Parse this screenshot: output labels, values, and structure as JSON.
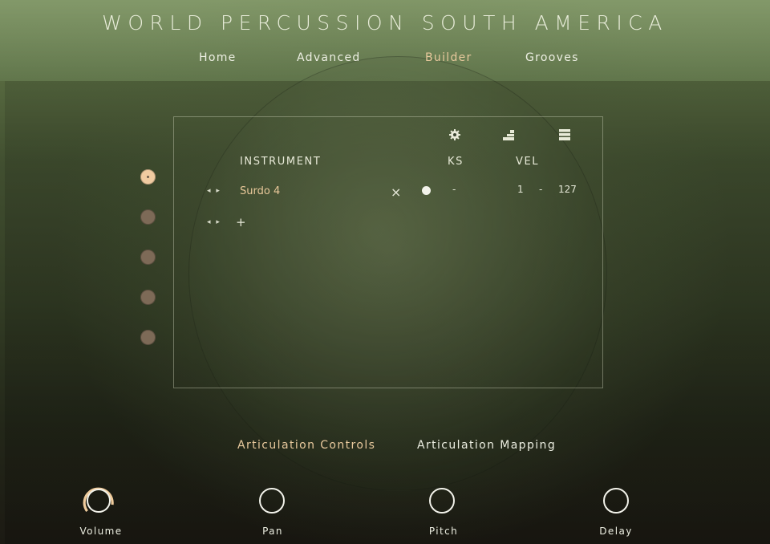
{
  "app": {
    "title": "WORLD PERCUSSION SOUTH AMERICA"
  },
  "nav": [
    {
      "label": "Home",
      "active": false
    },
    {
      "label": "Advanced",
      "active": false
    },
    {
      "label": "Builder",
      "active": true
    },
    {
      "label": "Grooves",
      "active": false
    }
  ],
  "builder": {
    "header_icons": [
      "gear-icon",
      "stairs-icon",
      "list-icon"
    ],
    "columns": {
      "instrument": "INSTRUMENT",
      "ks": "KS",
      "vel": "VEL"
    },
    "rows": [
      {
        "instrument": "Surdo 4",
        "ks_from": "-",
        "vel_low": "1",
        "vel_sep": "-",
        "vel_high": "127"
      }
    ],
    "add_label": "+",
    "remove_label": "×",
    "arrows": "◂ ▸",
    "slots": [
      {
        "active": true
      },
      {
        "active": false
      },
      {
        "active": false
      },
      {
        "active": false
      },
      {
        "active": false
      }
    ]
  },
  "tabs": [
    {
      "label": "Articulation Controls",
      "active": true
    },
    {
      "label": "Articulation Mapping",
      "active": false
    }
  ],
  "knobs": [
    {
      "label": "Volume",
      "value": 0.62
    },
    {
      "label": "Pan",
      "value": 0
    },
    {
      "label": "Pitch",
      "value": 0
    },
    {
      "label": "Delay",
      "value": 0
    }
  ],
  "colors": {
    "accent": "#e8c99d",
    "text": "#eceee1",
    "slot_inactive": "#7d6a57",
    "slot_active": "#f0cba1"
  }
}
